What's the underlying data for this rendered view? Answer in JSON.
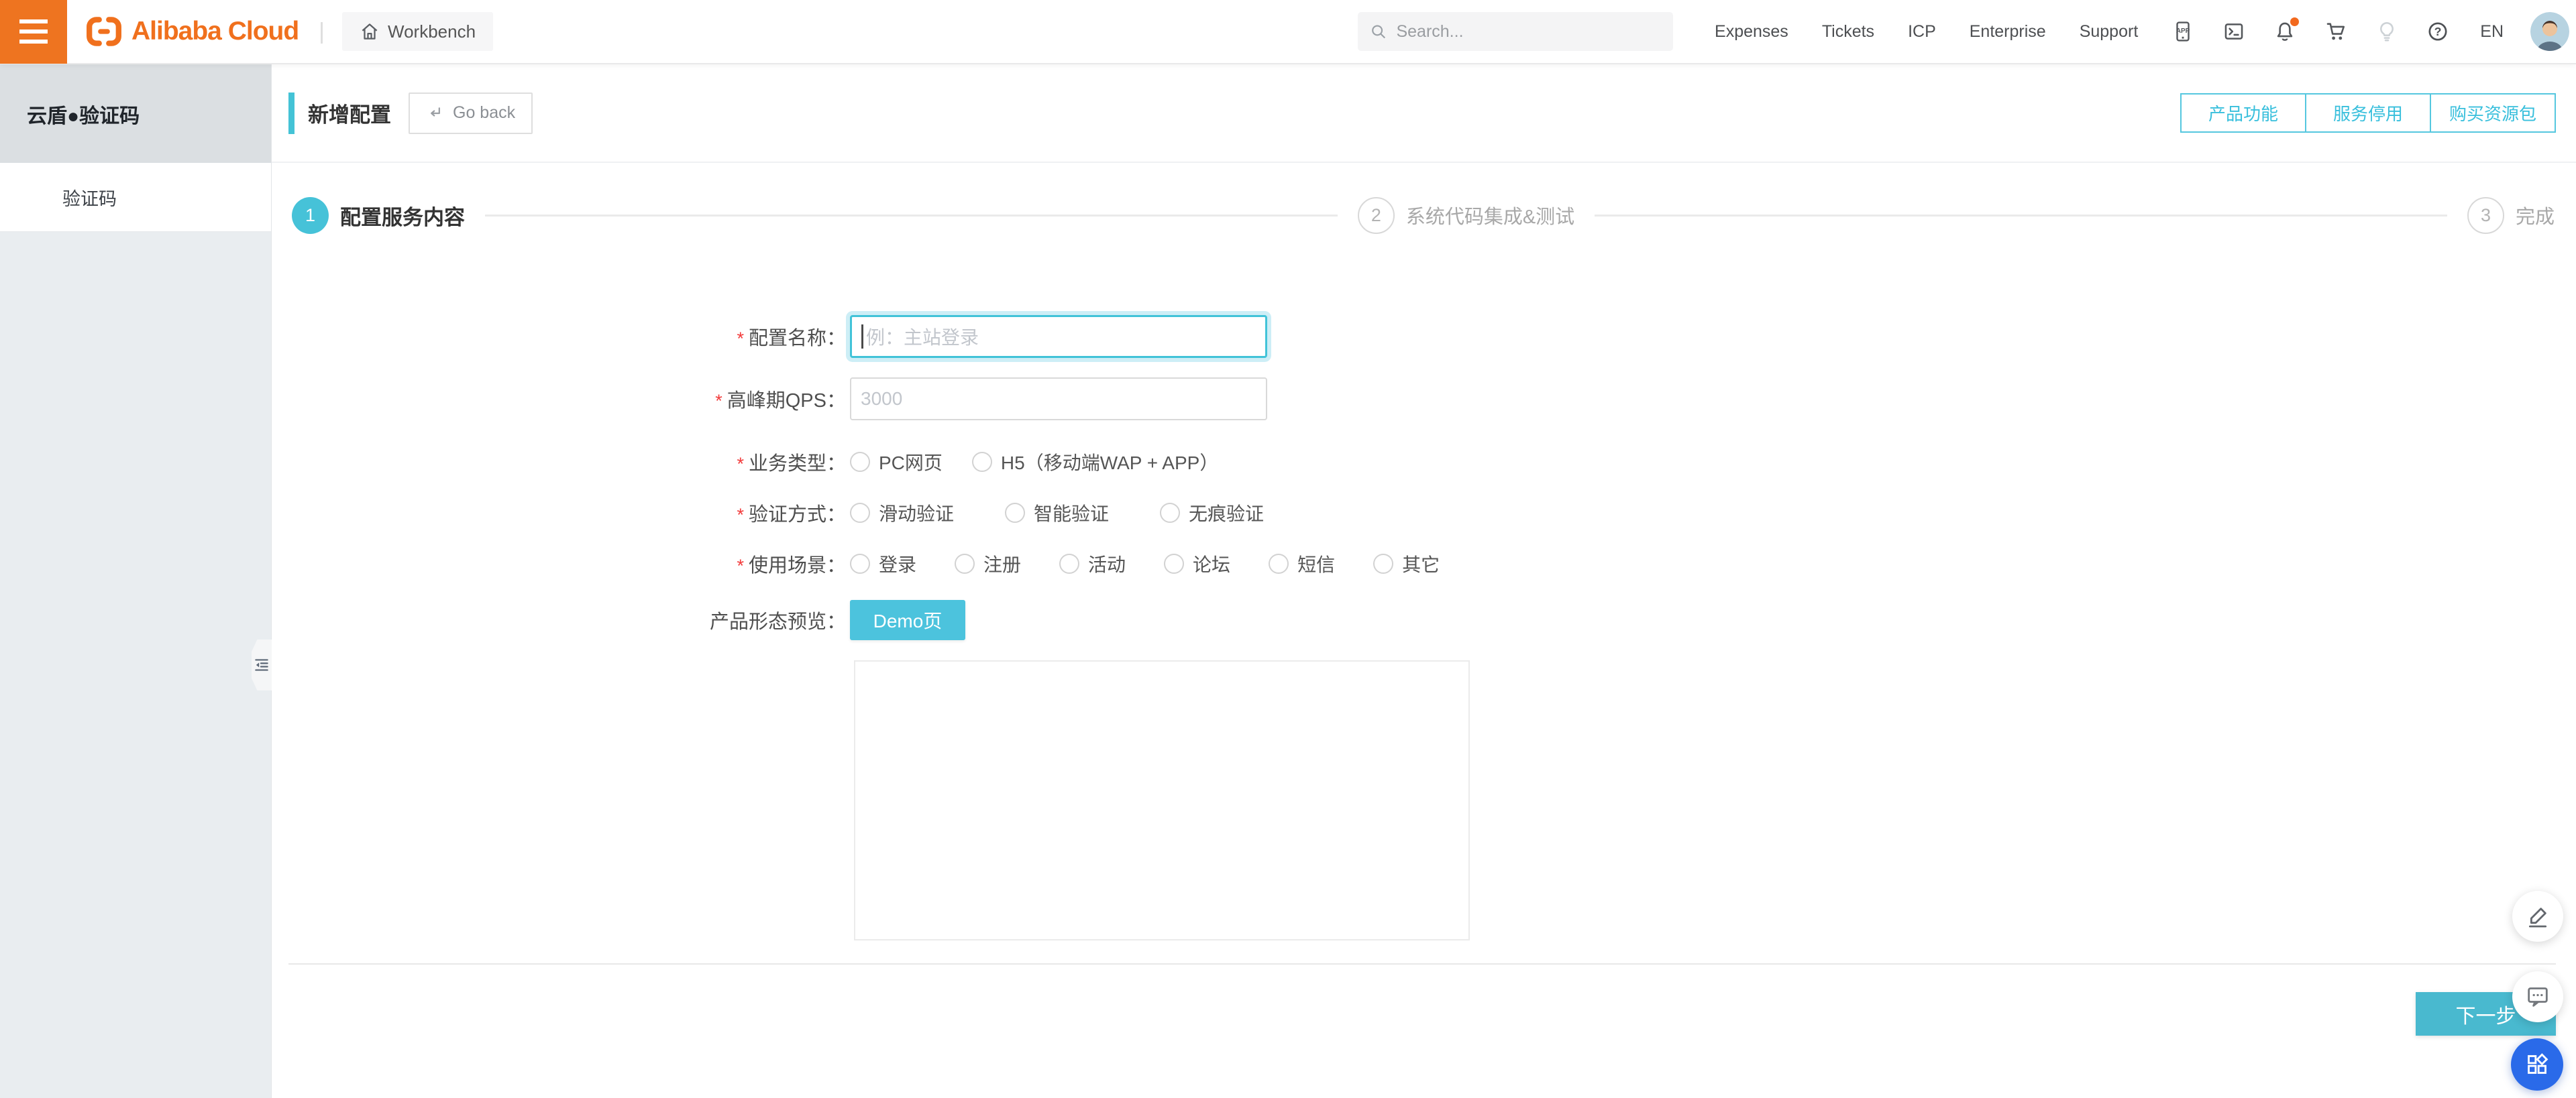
{
  "topbar": {
    "workbench_label": "Workbench",
    "search_placeholder": "Search...",
    "links": [
      "Expenses",
      "Tickets",
      "ICP",
      "Enterprise",
      "Support"
    ],
    "icons": [
      "mobile-app",
      "console",
      "notifications",
      "shopping-cart",
      "lightbulb",
      "help"
    ],
    "language": "EN"
  },
  "brand": {
    "logo_text": "Alibaba Cloud"
  },
  "sidebar": {
    "product_title": "云盾●验证码",
    "menu_item": "验证码"
  },
  "page": {
    "title": "新增配置",
    "go_back_label": "Go back",
    "actions": [
      "产品功能",
      "服务停用",
      "购买资源包"
    ]
  },
  "steps": [
    {
      "num": "1",
      "label": "配置服务内容"
    },
    {
      "num": "2",
      "label": "系统代码集成&测试"
    },
    {
      "num": "3",
      "label": "完成"
    }
  ],
  "form": {
    "config_name": {
      "label": "配置名称：",
      "required": true,
      "placeholder": "例：主站登录",
      "value": ""
    },
    "qps": {
      "label": "高峰期QPS：",
      "required": true,
      "placeholder": "3000",
      "value": ""
    },
    "business": {
      "label": "业务类型：",
      "required": true,
      "options": [
        "PC网页",
        "H5（移动端WAP + APP）"
      ],
      "selected": ""
    },
    "verify": {
      "label": "验证方式：",
      "required": true,
      "options": [
        "滑动验证",
        "智能验证",
        "无痕验证"
      ],
      "selected": ""
    },
    "scene": {
      "label": "使用场景：",
      "required": true,
      "options": [
        "登录",
        "注册",
        "活动",
        "论坛",
        "短信",
        "其它"
      ],
      "selected": ""
    },
    "preview": {
      "label": "产品形态预览：",
      "demo_button": "Demo页"
    }
  },
  "footer": {
    "next_button": "下一步"
  },
  "float_buttons": [
    "edit",
    "feedback",
    "apps"
  ],
  "colors": {
    "brand_orange": "#EE7420",
    "accent_cyan": "#46C2D8",
    "outline_button_cyan": "#55C7DF",
    "next_button_cyan": "#49B9CF",
    "required_red": "#F23C3C",
    "notification_orange": "#F2691E",
    "float_blue": "#2A6AE9",
    "sidebar_gray": "#E9EDF0"
  }
}
